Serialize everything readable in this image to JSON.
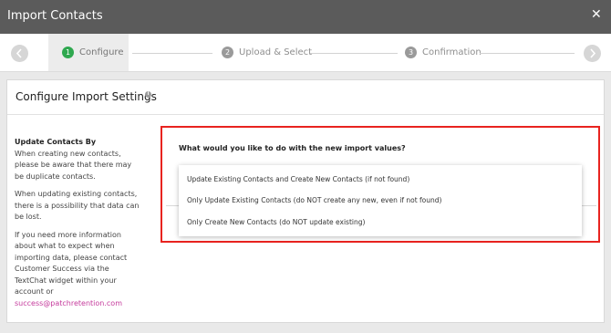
{
  "window": {
    "title": "Import Contacts",
    "close_glyph": "✕"
  },
  "steps": [
    {
      "number": "1",
      "label": "Configure",
      "active": true
    },
    {
      "number": "2",
      "label": "Upload & Select",
      "active": false
    },
    {
      "number": "3",
      "label": "Confirmation",
      "active": false
    }
  ],
  "nav": {
    "prev_icon": "chevron-left-icon",
    "next_icon": "chevron-right-icon"
  },
  "card": {
    "title": "Configure Import Settings",
    "info_glyph": "i"
  },
  "sidebar": {
    "heading": "Update Contacts By",
    "para1": "When creating new contacts, please be aware that there may be duplicate contacts.",
    "para2": "When updating existing contacts, there is a possibility that data can be lost.",
    "para3": "If you need more information about what to expect when importing data, please contact Customer Success via the TextChat widget within your account or",
    "email": "success@patchretention.com"
  },
  "form": {
    "question": "What would you like to do with the new import values?",
    "options": [
      "Update Existing Contacts and Create New Contacts (if not found)",
      "Only Update Existing Contacts (do NOT create any new, even if not found)",
      "Only Create New Contacts (do NOT update existing)"
    ]
  },
  "colors": {
    "titlebar": "#5b5b5b",
    "active_step": "#2fa84f",
    "highlight_border": "#e8231f",
    "link": "#c53a9c"
  }
}
